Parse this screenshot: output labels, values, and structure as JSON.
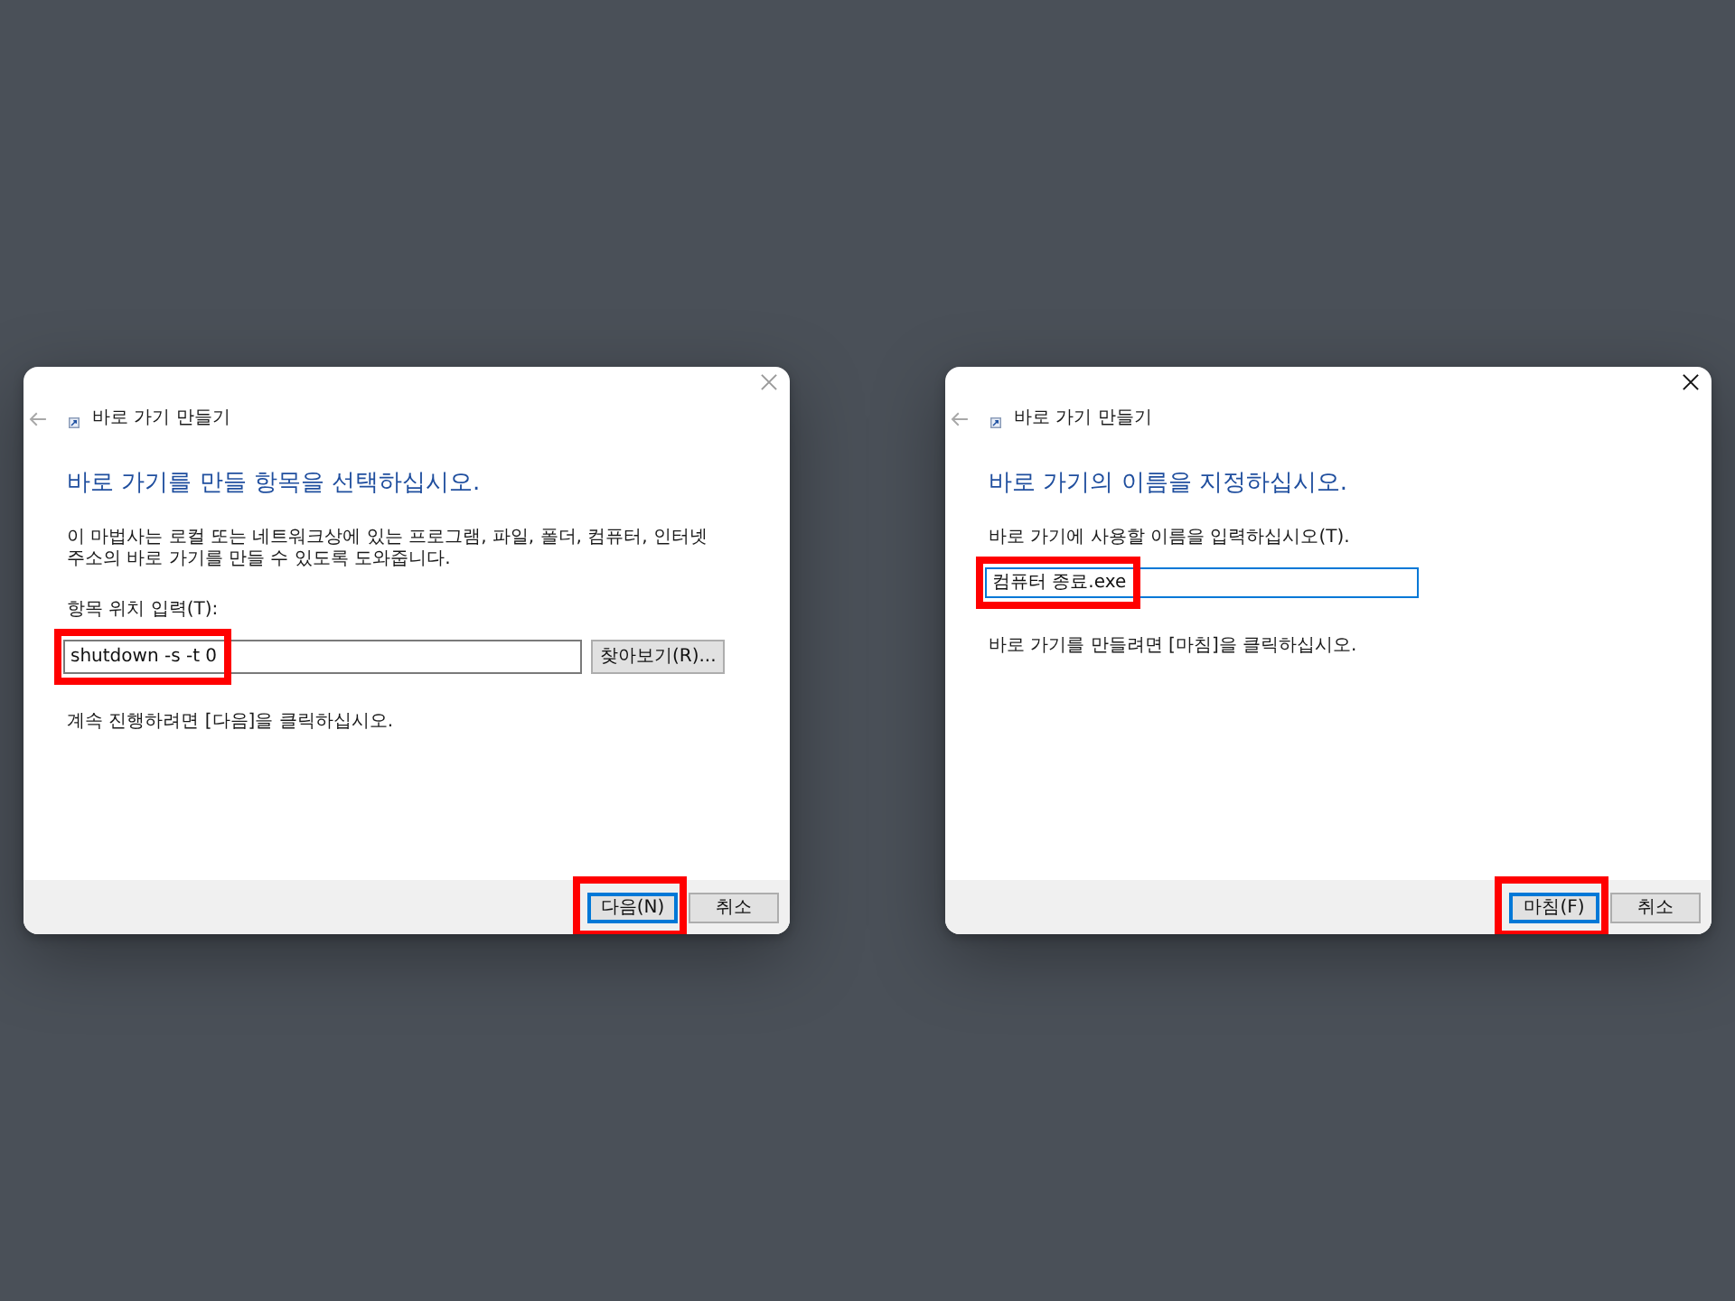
{
  "dialogs": [
    {
      "active": false,
      "title": "바로 가기 만들기",
      "back_disabled": true,
      "heading": "바로 가기를 만들 항목을 선택하십시오.",
      "description": "이 마법사는 로컬 또는 네트워크상에 있는 프로그램, 파일, 폴더, 컴퓨터, 인터넷 주소의 바로 가기를 만들 수 있도록 도와줍니다.",
      "field": {
        "label": "항목 위치 입력(T):",
        "value": "shutdown -s -t 0",
        "focused": false,
        "highlighted": true
      },
      "browse_button": "찾아보기(R)...",
      "instruction": "계속 진행하려면 [다음]을 클릭하십시오.",
      "buttons": [
        {
          "label": "다음(N)",
          "default": true,
          "highlighted": true
        },
        {
          "label": "취소",
          "default": false,
          "highlighted": false
        }
      ]
    },
    {
      "active": true,
      "title": "바로 가기 만들기",
      "back_disabled": true,
      "heading": "바로 가기의 이름을 지정하십시오.",
      "field": {
        "label": "바로 가기에 사용할 이름을 입력하십시오(T).",
        "value": "컴퓨터 종료.exe",
        "focused": true,
        "highlighted": true
      },
      "instruction": "바로 가기를 만들려면 [마침]을 클릭하십시오.",
      "buttons": [
        {
          "label": "마침(F)",
          "default": true,
          "highlighted": true
        },
        {
          "label": "취소",
          "default": false,
          "highlighted": false
        }
      ]
    }
  ]
}
